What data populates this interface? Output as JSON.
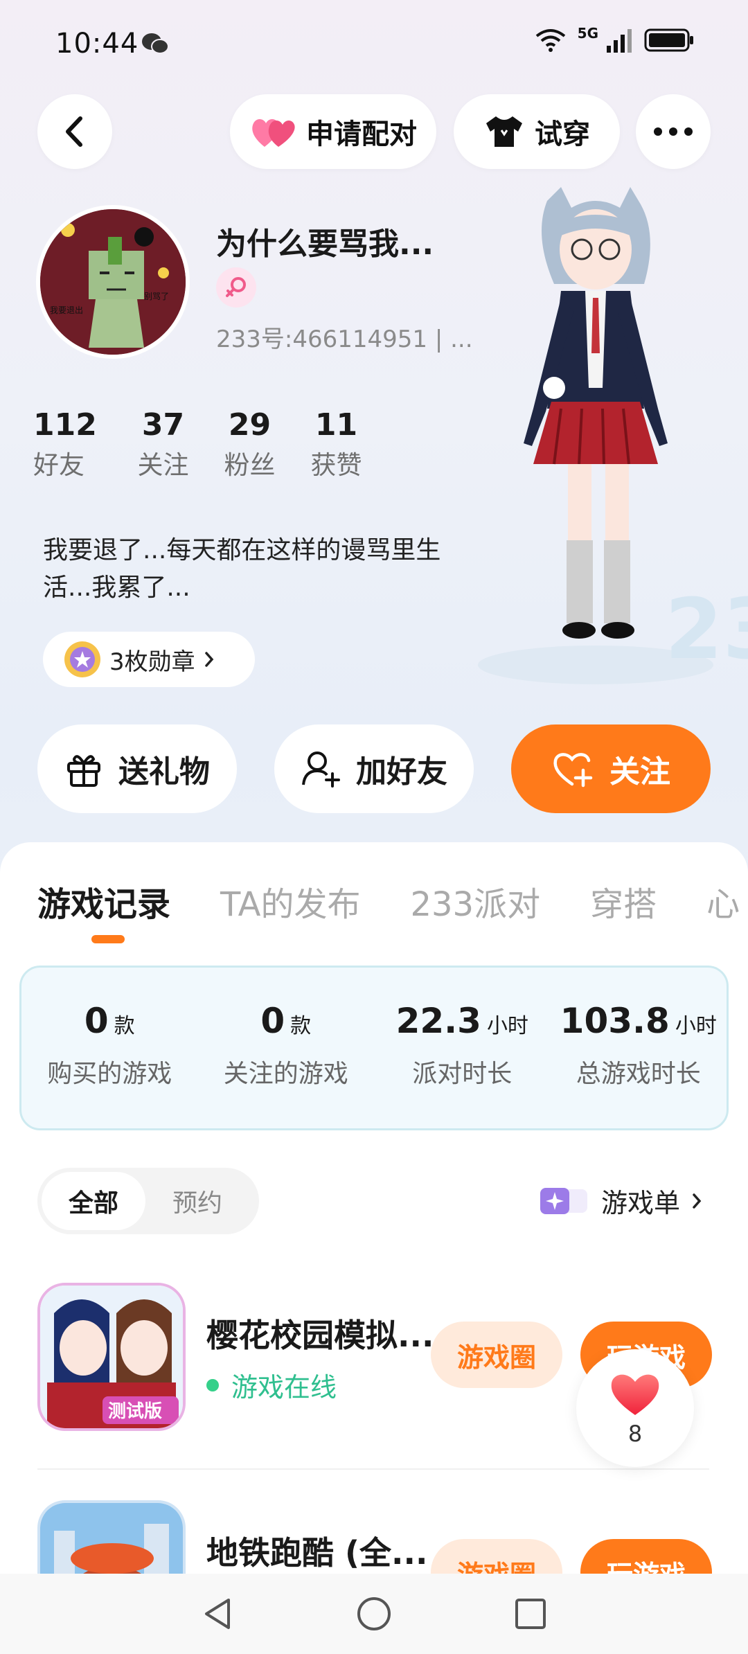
{
  "status_bar": {
    "time": "10:44",
    "network": "5G",
    "icons": [
      "wechat-icon",
      "wifi-icon",
      "signal-icon",
      "battery-icon"
    ]
  },
  "top_bar": {
    "back_icon": "chevron-left-icon",
    "pair_label": "申请配对",
    "try_label": "试穿",
    "more_icon": "more-dots-icon"
  },
  "profile": {
    "nickname": "为什么要骂我...",
    "gender": "female",
    "uid": "233号:466114951 | ...",
    "stats": [
      {
        "value": "112",
        "label": "好友"
      },
      {
        "value": "37",
        "label": "关注"
      },
      {
        "value": "29",
        "label": "粉丝"
      },
      {
        "value": "11",
        "label": "获赞"
      }
    ],
    "bio": "我要退了...每天都在这样的谩骂里生活...我累了...",
    "medals_label": "3枚勋章"
  },
  "actions": {
    "gift": "送礼物",
    "add_friend": "加好友",
    "follow": "关注"
  },
  "tabs": [
    "游戏记录",
    "TA的发布",
    "233派对",
    "穿搭",
    "心"
  ],
  "active_tab": 0,
  "game_stats": [
    {
      "value": "0",
      "unit": "款",
      "label": "购买的游戏"
    },
    {
      "value": "0",
      "unit": "款",
      "label": "关注的游戏"
    },
    {
      "value": "22.3",
      "unit": "小时",
      "label": "派对时长"
    },
    {
      "value": "103.8",
      "unit": "小时",
      "label": "总游戏时长"
    }
  ],
  "filter": {
    "all": "全部",
    "reserve": "预约"
  },
  "game_list_link": "游戏单",
  "games": [
    {
      "title": "樱花校园模拟...",
      "status": "游戏在线",
      "circle": "游戏圈",
      "play": "玩游戏"
    },
    {
      "title": "地铁跑酷 (全...",
      "status": "",
      "circle": "游戏圈",
      "play": "玩游戏"
    }
  ],
  "like_float": {
    "count": "8"
  },
  "colors": {
    "accent": "#ff7a1a",
    "online": "#2fbf8f",
    "pink": "#f05a8a"
  }
}
